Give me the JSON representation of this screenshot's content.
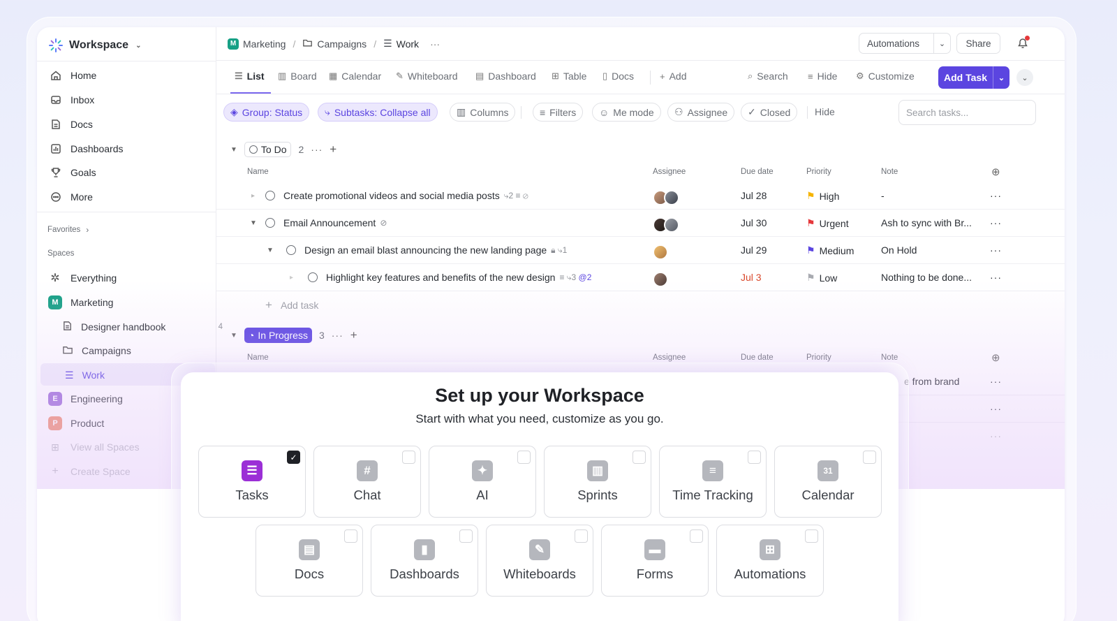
{
  "workspace": {
    "name": "Workspace"
  },
  "sidebar": {
    "nav": [
      {
        "label": "Home",
        "icon": "home-icon"
      },
      {
        "label": "Inbox",
        "icon": "inbox-icon"
      },
      {
        "label": "Docs",
        "icon": "doc-icon"
      },
      {
        "label": "Dashboards",
        "icon": "dashboard-icon"
      },
      {
        "label": "Goals",
        "icon": "trophy-icon"
      },
      {
        "label": "More",
        "icon": "more-icon"
      }
    ],
    "favorites_label": "Favorites",
    "spaces_label": "Spaces",
    "everything": "Everything",
    "spaces": [
      {
        "label": "Marketing",
        "letter": "M",
        "color": "#16a085"
      },
      {
        "label": "Engineering",
        "letter": "E",
        "color": "#9b6ad8"
      },
      {
        "label": "Product",
        "letter": "P",
        "color": "#f08a6b"
      }
    ],
    "marketing_children": {
      "handbook": "Designer handbook",
      "handbook_count": "4",
      "campaigns": "Campaigns",
      "work": "Work"
    },
    "view_all": "View all Spaces",
    "create": "Create Space"
  },
  "breadcrumb": {
    "space": "Marketing",
    "space_letter": "M",
    "folder": "Campaigns",
    "list": "Work",
    "more": "···"
  },
  "topbar": {
    "automations": "Automations",
    "share": "Share"
  },
  "tabs": {
    "items": [
      "List",
      "Board",
      "Calendar",
      "Whiteboard",
      "Dashboard",
      "Table",
      "Docs"
    ],
    "add": "Add",
    "search": "Search",
    "hide": "Hide",
    "customize": "Customize",
    "add_task": "Add Task"
  },
  "filters": {
    "group": "Group: Status",
    "subtasks": "Subtasks: Collapse all",
    "columns": "Columns",
    "filters": "Filters",
    "me_mode": "Me mode",
    "assignee": "Assignee",
    "closed": "Closed",
    "hide": "Hide",
    "search_placeholder": "Search tasks..."
  },
  "columns": {
    "name": "Name",
    "assignee": "Assignee",
    "due": "Due date",
    "priority": "Priority",
    "note": "Note"
  },
  "groups": {
    "todo": {
      "label": "To Do",
      "count": "2"
    },
    "inprogress": {
      "label": "In Progress",
      "count": "3"
    }
  },
  "tasks": [
    {
      "name": "Create promotional videos and social media posts",
      "meta": "2",
      "due": "Jul 28",
      "priority": "High",
      "priority_color": "#f5b400",
      "note": "-"
    },
    {
      "name": "Email Announcement",
      "meta": "",
      "due": "Jul 30",
      "priority": "Urgent",
      "priority_color": "#e5383b",
      "note": "Ash to sync with Br..."
    },
    {
      "name": "Design an email blast announcing the new landing page",
      "meta": "1",
      "due": "Jul 29",
      "priority": "Medium",
      "priority_color": "#5b45e0",
      "note": "On Hold"
    },
    {
      "name": "Highlight key features and benefits of the new design",
      "meta": "3",
      "meta2": "2",
      "due": "Jul 3",
      "due_color": "#d9472b",
      "priority": "Low",
      "priority_color": "#a8aab0",
      "note": "Nothing to be done..."
    }
  ],
  "add_task_label": "Add task",
  "inprogress_note_fragment": "e from brand",
  "modal": {
    "title": "Set up your Workspace",
    "subtitle": "Start with what you need, customize as you go.",
    "row1": [
      "Tasks",
      "Chat",
      "AI",
      "Sprints",
      "Time Tracking",
      "Calendar"
    ],
    "row2": [
      "Docs",
      "Dashboards",
      "Whiteboards",
      "Forms",
      "Automations"
    ],
    "calendar_day": "31"
  }
}
